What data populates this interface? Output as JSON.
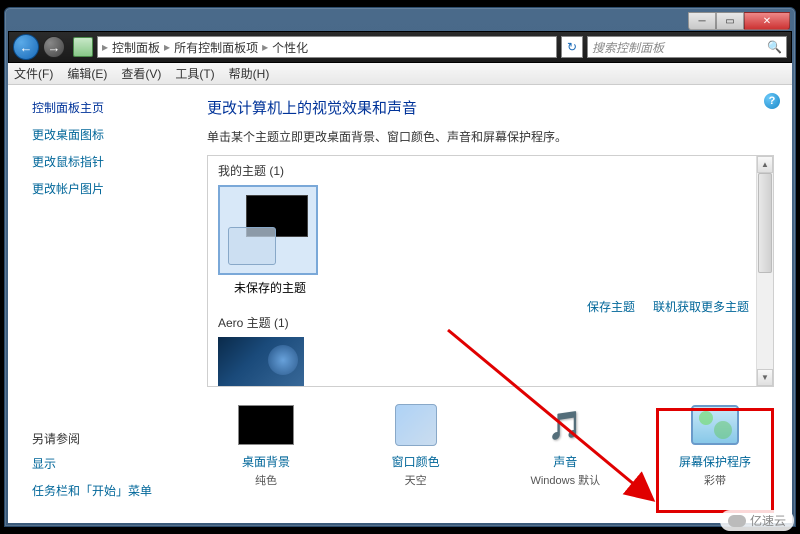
{
  "breadcrumb": {
    "level1": "控制面板",
    "level2": "所有控制面板项",
    "level3": "个性化"
  },
  "search": {
    "placeholder": "搜索控制面板"
  },
  "menus": {
    "file": "文件(F)",
    "edit": "编辑(E)",
    "view": "查看(V)",
    "tools": "工具(T)",
    "help": "帮助(H)"
  },
  "sidebar": {
    "home": "控制面板主页",
    "links": [
      "更改桌面图标",
      "更改鼠标指针",
      "更改帐户图片"
    ],
    "seeAlso": "另请参阅",
    "seeAlsoLinks": [
      "显示",
      "任务栏和「开始」菜单"
    ]
  },
  "main": {
    "title": "更改计算机上的视觉效果和声音",
    "desc": "单击某个主题立即更改桌面背景、窗口颜色、声音和屏幕保护程序。",
    "myThemesLabel": "我的主题 (1)",
    "unsavedTheme": "未保存的主题",
    "saveTheme": "保存主题",
    "getMoreThemes": "联机获取更多主题",
    "aeroLabel": "Aero 主题 (1)"
  },
  "bottom": {
    "bg": {
      "label": "桌面背景",
      "sub": "纯色"
    },
    "color": {
      "label": "窗口颜色",
      "sub": "天空"
    },
    "sound": {
      "label": "声音",
      "sub": "Windows 默认"
    },
    "ss": {
      "label": "屏幕保护程序",
      "sub": "彩带"
    }
  },
  "watermark": "亿速云"
}
